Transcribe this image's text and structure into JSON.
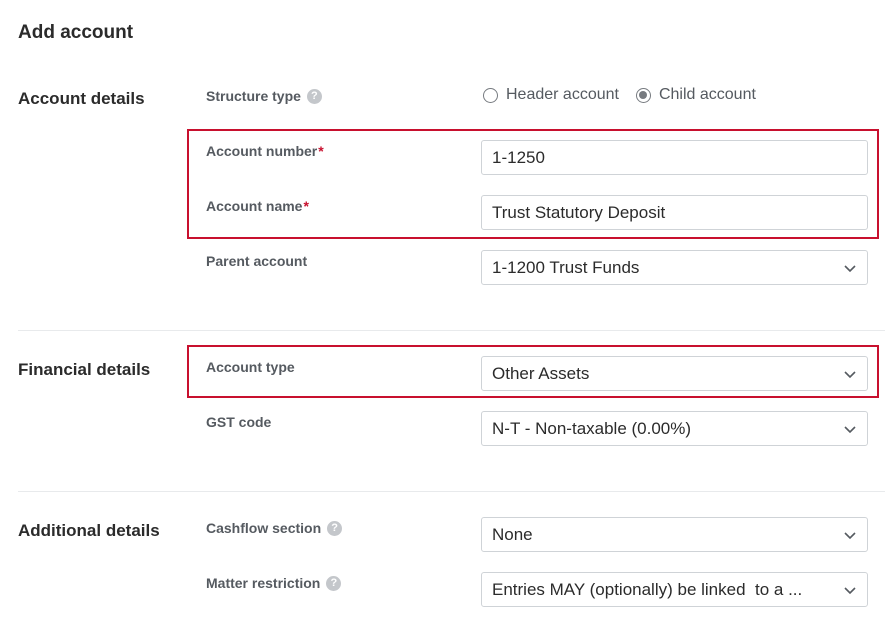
{
  "page": {
    "title": "Add account"
  },
  "sections": {
    "account": "Account details",
    "financial": "Financial details",
    "additional": "Additional details"
  },
  "fields": {
    "structure_type": {
      "label": "Structure type",
      "options": [
        "Header account",
        "Child account"
      ],
      "selected": "Child account"
    },
    "account_number": {
      "label": "Account number",
      "required_mark": "*",
      "value": "1-1250"
    },
    "account_name": {
      "label": "Account name",
      "required_mark": "*",
      "value": "Trust Statutory Deposit"
    },
    "parent_account": {
      "label": "Parent account",
      "value": "1-1200 Trust Funds"
    },
    "account_type": {
      "label": "Account type",
      "value": "Other Assets"
    },
    "gst_code": {
      "label": "GST code",
      "value": "N-T - Non-taxable (0.00%)"
    },
    "cashflow_section": {
      "label": "Cashflow section",
      "value": "None"
    },
    "matter_restriction": {
      "label": "Matter restriction",
      "value": "Entries MAY (optionally) be linked  to a ..."
    }
  },
  "icons": {
    "help": "help-circle-icon",
    "dropdown": "chevron-down-icon"
  },
  "colors": {
    "highlight": "#c8102e",
    "required": "#c8102e",
    "label": "#555a60"
  },
  "help_glyph": "?"
}
